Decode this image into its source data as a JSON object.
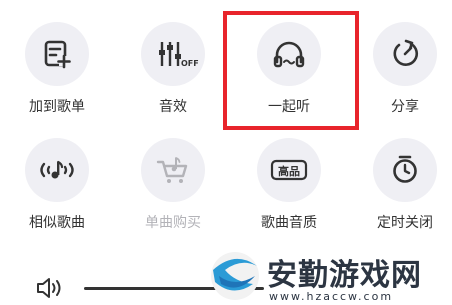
{
  "menu": {
    "row1": [
      {
        "label": "加到歌单",
        "icon": "add-to-playlist-icon"
      },
      {
        "label": "音效",
        "icon": "equalizer-icon",
        "icon_text": "OFF"
      },
      {
        "label": "一起听",
        "icon": "headphones-icon"
      },
      {
        "label": "分享",
        "icon": "share-icon"
      }
    ],
    "row2": [
      {
        "label": "相似歌曲",
        "icon": "similar-songs-icon"
      },
      {
        "label": "单曲购买",
        "icon": "purchase-icon",
        "disabled": true
      },
      {
        "label": "歌曲音质",
        "icon": "quality-icon",
        "icon_text": "高品"
      },
      {
        "label": "定时关闭",
        "icon": "timer-icon"
      }
    ]
  },
  "highlight_color": "#e8242b",
  "watermark": {
    "title": "安勤游戏网",
    "url": "www.hzaccw.com"
  }
}
